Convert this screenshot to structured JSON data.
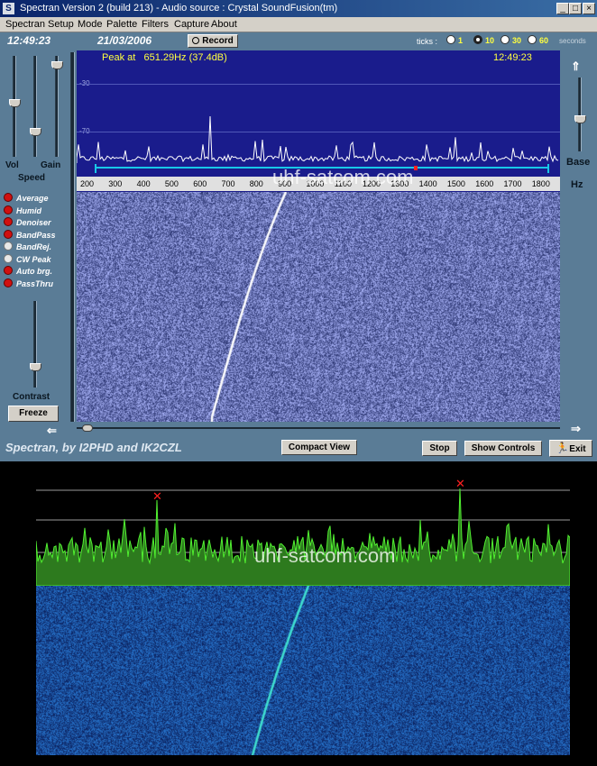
{
  "window": {
    "title": "Spectran Version 2  (build 213) - Audio source : Crystal SoundFusion(tm)",
    "icon": "spectran-app-icon",
    "min_label": "_",
    "max_label": "□",
    "close_label": "×"
  },
  "menu": [
    "Spectran",
    "Setup",
    "Mode",
    "Palette",
    "Filters",
    "Capture",
    "About"
  ],
  "toolbar": {
    "time": "12:49:23",
    "date": "21/03/2006",
    "record_label": "Record",
    "ticks_label": "ticks :",
    "tick_options": [
      "1",
      "10",
      "30",
      "60"
    ],
    "tick_selected": "10",
    "ticks_unit": "seconds"
  },
  "left_panel": {
    "vol_label": "Vol",
    "gain_label": "Gain",
    "speed_label": "Speed",
    "contrast_label": "Contrast",
    "freeze_label": "Freeze",
    "checks": [
      {
        "label": "Average",
        "on": true
      },
      {
        "label": "Humid",
        "on": true
      },
      {
        "label": "Denoiser",
        "on": true
      },
      {
        "label": "BandPass",
        "on": true
      },
      {
        "label": "BandRej.",
        "on": false
      },
      {
        "label": "CW Peak",
        "on": false
      },
      {
        "label": "Auto brg.",
        "on": true
      },
      {
        "label": "PassThru",
        "on": true
      }
    ]
  },
  "right_panel": {
    "base_label": "Base",
    "hz_label": "Hz"
  },
  "spectrum": {
    "peak_text": "Peak at   651.29Hz (37.4dB)",
    "time": "12:49:23",
    "db_labels": [
      "-30",
      "-70"
    ],
    "freq_ticks": [
      "200",
      "300",
      "400",
      "500",
      "600",
      "700",
      "800",
      "900",
      "1000",
      "1100",
      "1200",
      "1300",
      "1400",
      "1500",
      "1600",
      "1700",
      "1800"
    ]
  },
  "bottom_buttons": {
    "compact_label": "Compact View",
    "stop_label": "Stop",
    "show_controls_label": "Show Controls",
    "exit_label": "Exit"
  },
  "branding": "Spectran, by I2PHD and IK2CZL",
  "watermark": "uhf-satcom.com",
  "colors": {
    "app_bg": "#5a7c96",
    "spectrum_bg": "#1a1c8c",
    "lower_trace": "#40e020",
    "marker": "#ff2020"
  }
}
